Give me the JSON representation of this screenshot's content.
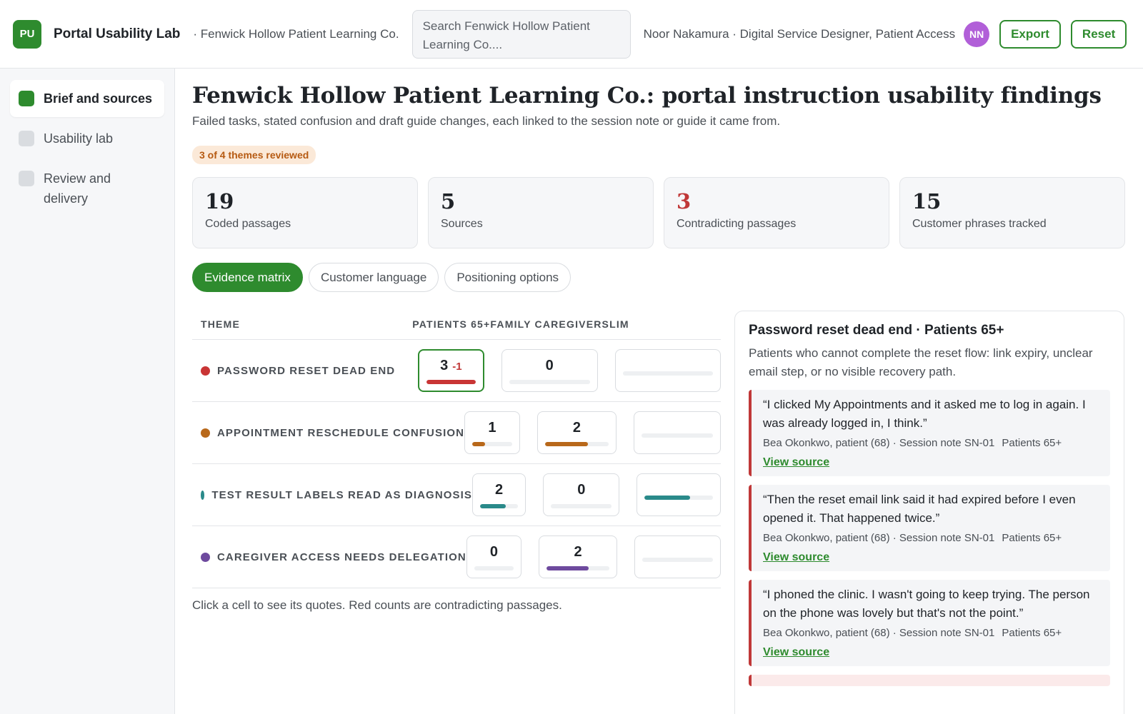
{
  "app": {
    "logo_text": "PU",
    "title": "Portal Usability Lab",
    "org_crumb": "· Fenwick Hollow Patient Learning Co.",
    "search_text": "Search Fenwick Hollow Patient Learning Co....",
    "user_line": "Noor Nakamura · Digital Service Designer, Patient Access",
    "avatar_initials": "NN",
    "export_label": "Export",
    "reset_label": "Reset"
  },
  "sidebar": {
    "items": [
      {
        "label": "Brief and sources",
        "active": true
      },
      {
        "label": "Usability lab",
        "active": false
      },
      {
        "label": "Review and delivery",
        "active": false
      }
    ]
  },
  "main": {
    "title": "Fenwick Hollow Patient Learning Co.: portal instruction usability findings",
    "subtitle": "Failed tasks, stated confusion and draft guide changes, each linked to the session note or guide it came from.",
    "progress_badge": "3 of 4 themes reviewed",
    "stats": [
      {
        "value": "19",
        "label": "Coded passages"
      },
      {
        "value": "5",
        "label": "Sources"
      },
      {
        "value": "3",
        "label": "Contradicting passages"
      },
      {
        "value": "15",
        "label": "Customer phrases tracked"
      }
    ],
    "tabs": [
      {
        "label": "Evidence matrix",
        "active": true
      },
      {
        "label": "Customer language",
        "active": false
      },
      {
        "label": "Positioning options",
        "active": false
      }
    ]
  },
  "matrix": {
    "headers": {
      "theme": "THEME",
      "p65": "PATIENTS 65+",
      "fc": "FAMILY CAREGIVERS",
      "lim": "LIM"
    },
    "rows": [
      {
        "theme": "PASSWORD RESET DEAD END",
        "color": "#c93535",
        "p65": "3",
        "p65_neg": "-1",
        "p65_fill": 1.0,
        "fc": "0",
        "fc_fill": 0,
        "lim_fill": 0
      },
      {
        "theme": "APPOINTMENT RESCHEDULE CONFUSION",
        "color": "#b8681a",
        "p65": "1",
        "p65_fill": 0.33,
        "fc": "2",
        "fc_fill": 0.67,
        "lim_fill": 0
      },
      {
        "theme": "TEST RESULT LABELS READ AS DIAGNOSIS",
        "color": "#2a8a8a",
        "p65": "2",
        "p65_fill": 0.67,
        "fc": "0",
        "fc_fill": 0,
        "lim_fill": 0.67
      },
      {
        "theme": "CAREGIVER ACCESS NEEDS DELEGATION",
        "color": "#6e4a9e",
        "p65": "0",
        "p65_fill": 0,
        "fc": "2",
        "fc_fill": 0.67,
        "lim_fill": 0
      }
    ],
    "hint": "Click a cell to see its quotes. Red counts are contradicting passages."
  },
  "panel": {
    "title": "Password reset dead end · Patients 65+",
    "description": "Patients who cannot complete the reset flow: link expiry, unclear email step, or no visible recovery path.",
    "quotes": [
      {
        "text": "“I clicked My Appointments and it asked me to log in again. I was already logged in, I think.”",
        "source": "Bea Okonkwo, patient (68) · Session note SN-01",
        "segment": "Patients 65+",
        "link": "View source"
      },
      {
        "text": "“Then the reset email link said it had expired before I even opened it. That happened twice.”",
        "source": "Bea Okonkwo, patient (68) · Session note SN-01",
        "segment": "Patients 65+",
        "link": "View source"
      },
      {
        "text": "“I phoned the clinic. I wasn't going to keep trying. The person on the phone was lovely but that's not the point.”",
        "source": "Bea Okonkwo, patient (68) · Session note SN-01",
        "segment": "Patients 65+",
        "link": "View source"
      }
    ]
  }
}
